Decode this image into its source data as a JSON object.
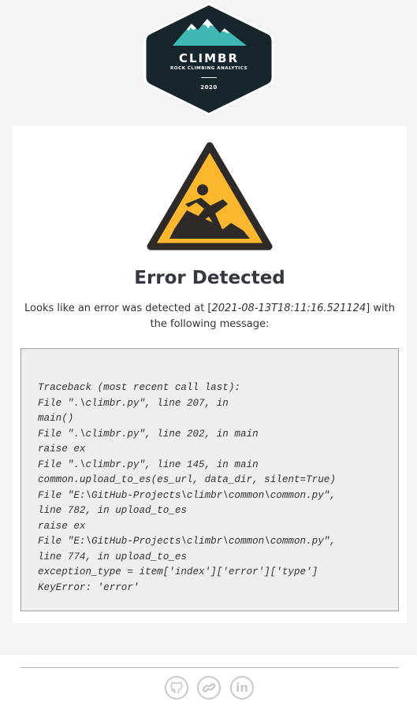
{
  "brand": {
    "name": "CLIMBR",
    "tagline": "ROCK CLIMBING ANALYTICS",
    "year": "2020",
    "colors": {
      "badge": "#17262d",
      "mountain": "#3fb7b2",
      "snow": "#ffffff"
    }
  },
  "error": {
    "icon": "warning-slip-icon",
    "title": "Error Detected",
    "message_prefix": "Looks like an error was detected at [",
    "timestamp": "2021-08-13T18:11:16.521124",
    "message_suffix": "] with the following message:",
    "traceback": [
      "Traceback (most recent call last):",
      "File \".\\climbr.py\", line 207, in",
      "main()",
      "File \".\\climbr.py\", line 202, in main",
      "raise ex",
      "File \".\\climbr.py\", line 145, in main",
      "common.upload_to_es(es_url, data_dir, silent=True)",
      "File \"E:\\GitHub-Projects\\climbr\\common\\common.py\",",
      "line 782, in upload_to_es",
      "raise ex",
      "File \"E:\\GitHub-Projects\\climbr\\common\\common.py\",",
      "line 774, in upload_to_es",
      "exception_type = item['index']['error']['type']",
      "KeyError: 'error'"
    ],
    "colors": {
      "warning_fill": "#fbb72d",
      "warning_stroke": "#2d2a27"
    }
  },
  "footer": {
    "links": [
      {
        "icon": "github-icon"
      },
      {
        "icon": "link-icon"
      },
      {
        "icon": "linkedin-icon",
        "label": "in"
      }
    ],
    "icon_color": "#c8c8c8"
  }
}
